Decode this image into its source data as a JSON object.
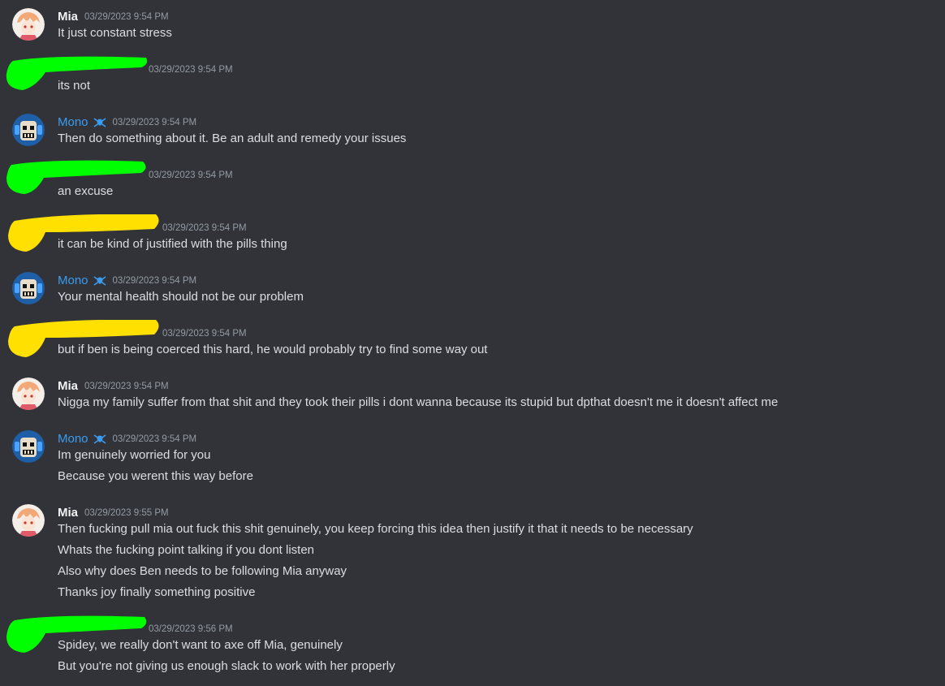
{
  "colors": {
    "background": "#313338",
    "text": "#dbdee1",
    "timestamp": "#949ba4",
    "mono_name": "#3b9cf0",
    "green_redaction": "#00ff00",
    "yellow_redaction": "#ffe000"
  },
  "messages": [
    {
      "author": "Mia",
      "timestamp": "03/29/2023 9:54 PM",
      "lines": [
        "It just constant stress"
      ]
    },
    {
      "author": "",
      "redaction": "green",
      "timestamp": "03/29/2023 9:54 PM",
      "lines": [
        "its not"
      ]
    },
    {
      "author": "Mono",
      "server_tag_icon": "skull-crossbones-icon",
      "timestamp": "03/29/2023 9:54 PM",
      "lines": [
        "Then do something about it. Be an adult and remedy your issues"
      ]
    },
    {
      "author": "",
      "redaction": "green",
      "timestamp": "03/29/2023 9:54 PM",
      "lines": [
        "an excuse"
      ]
    },
    {
      "author": "",
      "redaction": "yellow",
      "timestamp": "03/29/2023 9:54 PM",
      "lines": [
        "it can be kind of justified with the pills thing"
      ]
    },
    {
      "author": "Mono",
      "server_tag_icon": "skull-crossbones-icon",
      "timestamp": "03/29/2023 9:54 PM",
      "lines": [
        "Your mental health should not be our problem"
      ]
    },
    {
      "author": "",
      "redaction": "yellow",
      "timestamp": "03/29/2023 9:54 PM",
      "lines": [
        "but if ben is being coerced this hard, he would probably try to find some way out"
      ]
    },
    {
      "author": "Mia",
      "timestamp": "03/29/2023 9:54 PM",
      "lines": [
        "Nigga my family suffer from that shit and they took their pills i dont wanna because its stupid but dpthat doesn't me it doesn't affect me"
      ]
    },
    {
      "author": "Mono",
      "server_tag_icon": "skull-crossbones-icon",
      "timestamp": "03/29/2023 9:54 PM",
      "lines": [
        "Im genuinely worried for you",
        "Because you werent this way before"
      ]
    },
    {
      "author": "Mia",
      "timestamp": "03/29/2023 9:55 PM",
      "lines": [
        "Then fucking pull mia out fuck this shit genuinely, you keep forcing this idea then justify it that it needs to be necessary",
        "Whats the fucking point talking if you dont listen",
        "Also why does Ben needs to be following Mia anyway",
        "Thanks joy finally something positive"
      ]
    },
    {
      "author": "",
      "redaction": "green",
      "timestamp": "03/29/2023 9:56 PM",
      "lines": [
        "Spidey, we really don't want to axe off Mia, genuinely",
        "But you're not giving us enough slack to work with her properly"
      ]
    }
  ]
}
